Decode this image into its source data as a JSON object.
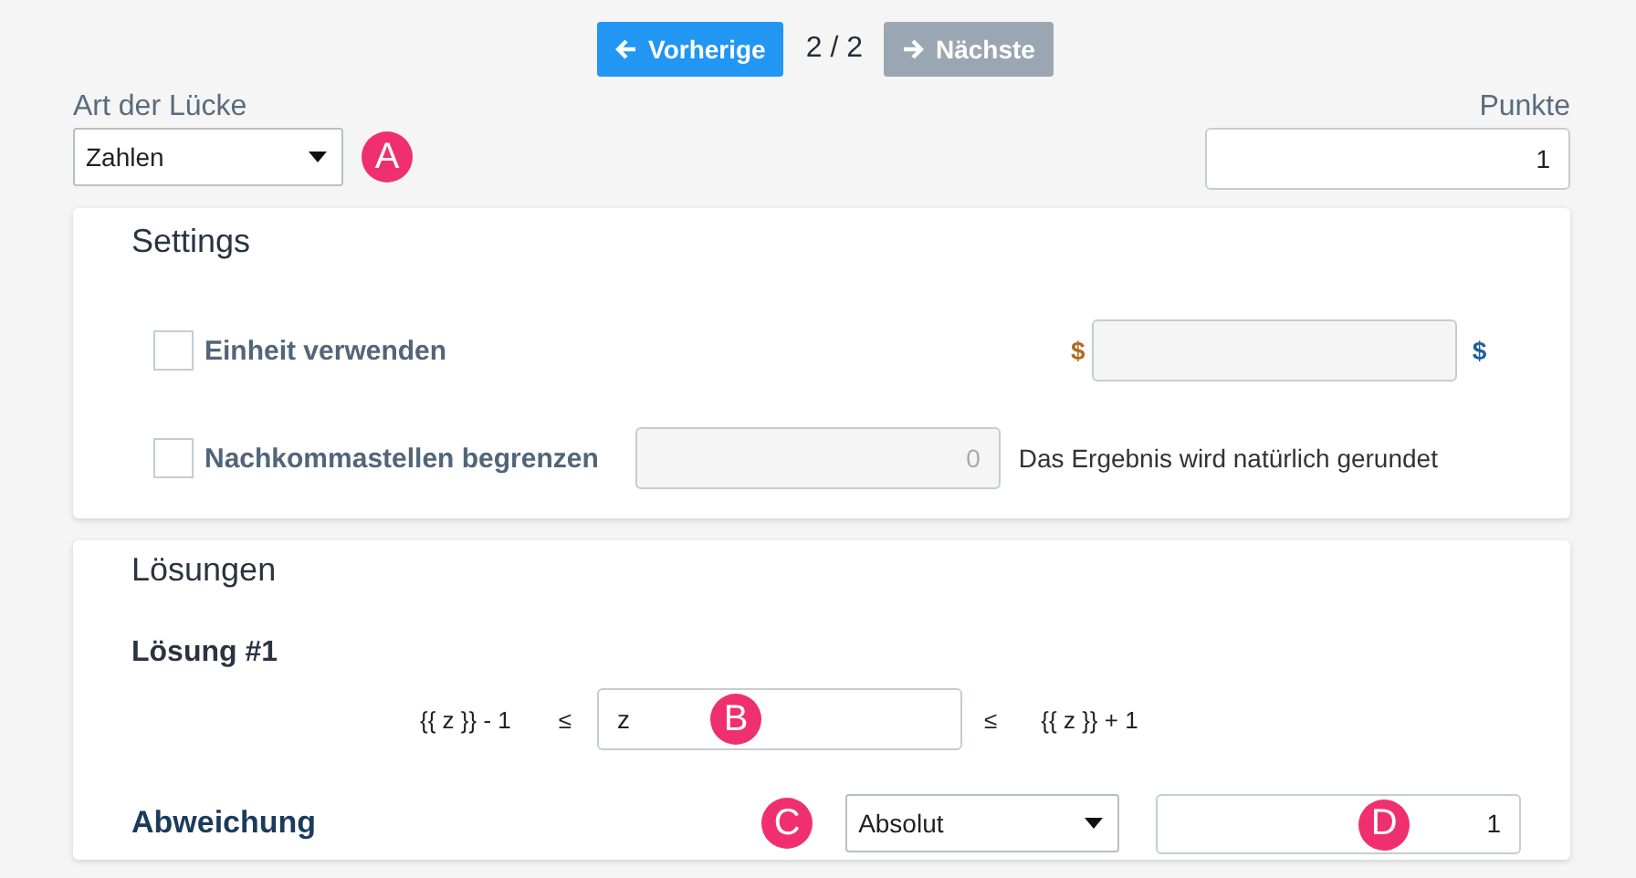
{
  "pager": {
    "previous": {
      "label": "Vorherige",
      "disabled": false
    },
    "position": "2 / 2",
    "next": {
      "label": "Nächste",
      "disabled": true
    }
  },
  "gap_type": {
    "label": "Art der Lücke",
    "value": "Zahlen",
    "badge": "A"
  },
  "points": {
    "label": "Punkte",
    "value": "1"
  },
  "settings": {
    "title": "Settings",
    "unit": {
      "label": "Einheit verwenden",
      "checked": false,
      "prefix": "$",
      "suffix": "$"
    },
    "decimals": {
      "label": "Nachkommastellen begrenzen",
      "checked": false,
      "placeholder": "0",
      "note": "Das Ergebnis wird natürlich gerundet"
    }
  },
  "solutions": {
    "title": "Lösungen",
    "items": [
      {
        "title": "Lösung #1",
        "lower": "{{ z }} - 1",
        "lower_op": "≤",
        "value": "z",
        "value_badge": "B",
        "upper_op": "≤",
        "upper": "{{ z }} + 1"
      }
    ],
    "deviation": {
      "label": "Abweichung",
      "badge": "C",
      "mode": "Absolut",
      "value": "1",
      "value_badge": "D"
    }
  }
}
